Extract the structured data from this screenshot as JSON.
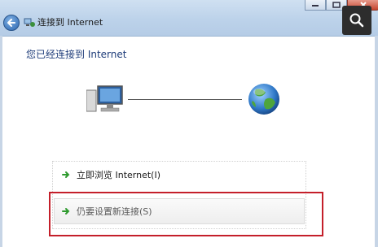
{
  "window": {
    "title": "连接到 Internet"
  },
  "content": {
    "heading": "您已经连接到 Internet"
  },
  "options": [
    {
      "label": "立即浏览 Internet(I)"
    },
    {
      "label": "仍要设置新连接(S)"
    }
  ],
  "colors": {
    "titlebar": "#bcd2ea",
    "heading_text": "#1f3d7a",
    "arrow_green": "#2e9a2e",
    "highlight_border": "#c41f2a"
  },
  "icons": [
    "back-arrow-icon",
    "network-icon",
    "search-icon",
    "computer-icon",
    "globe-icon",
    "arrow-right-icon"
  ]
}
